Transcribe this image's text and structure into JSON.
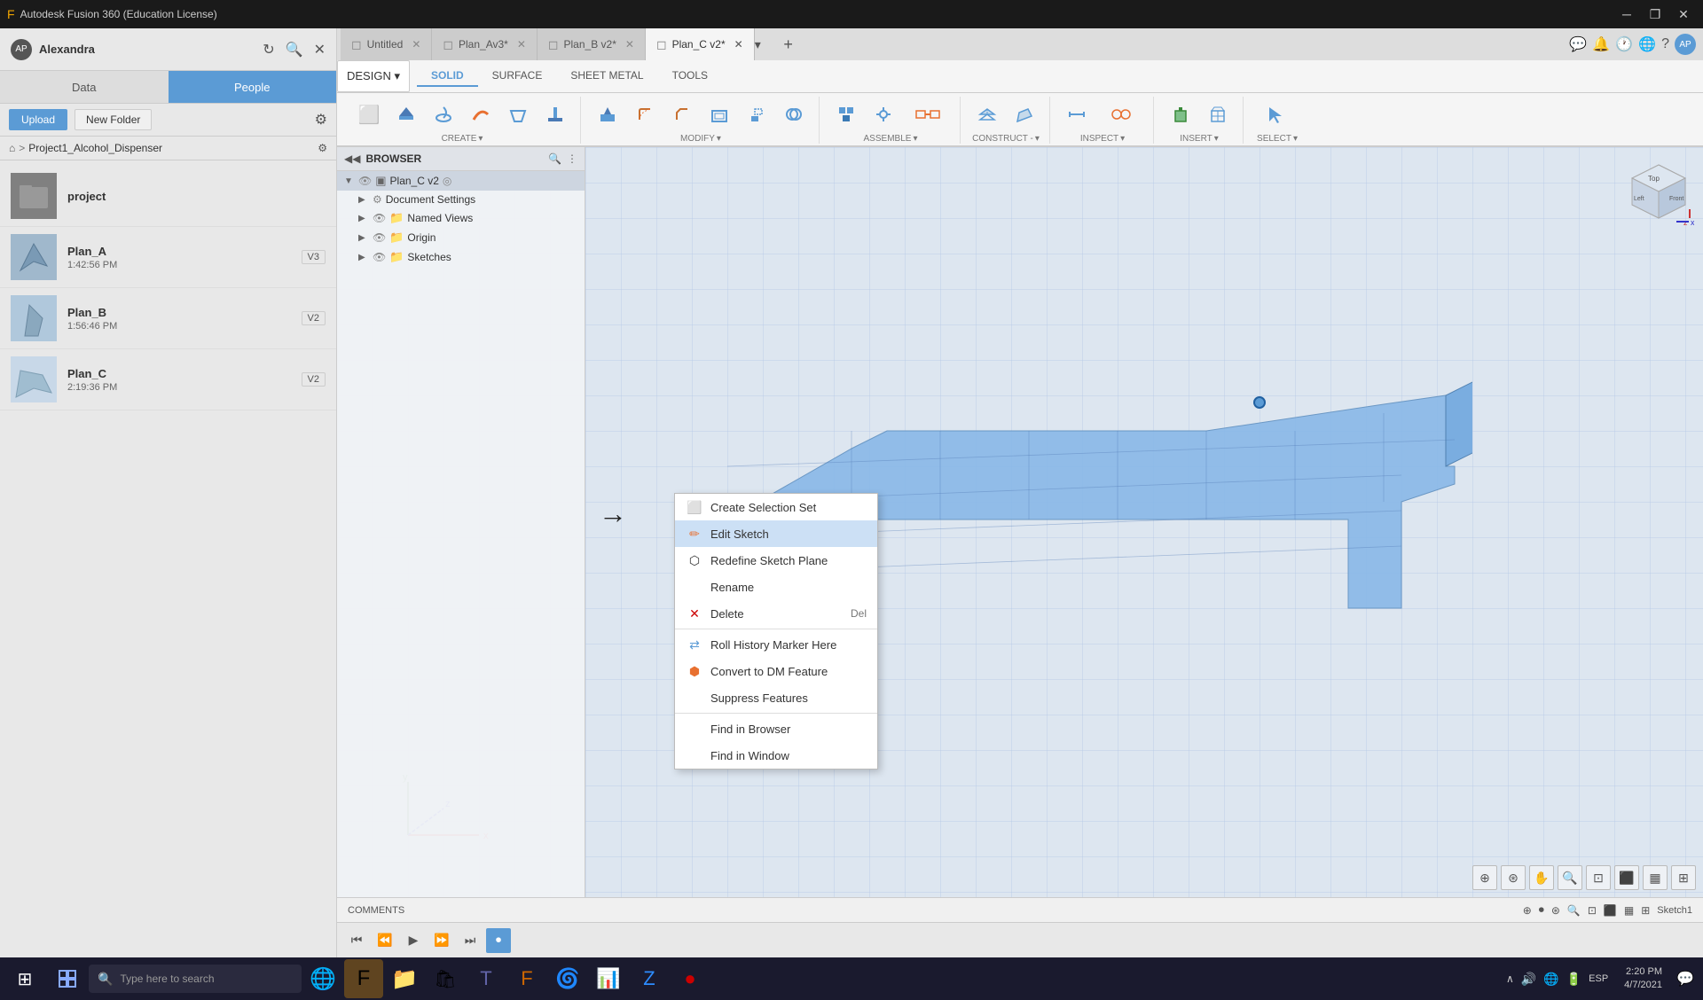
{
  "app": {
    "title": "Autodesk Fusion 360 (Education License)",
    "window_controls": [
      "minimize",
      "restore",
      "close"
    ]
  },
  "user": {
    "name": "Alexandra",
    "initials": "AP"
  },
  "left_panel": {
    "tabs": [
      {
        "id": "data",
        "label": "Data",
        "active": false
      },
      {
        "id": "people",
        "label": "People",
        "active": true
      }
    ],
    "toolbar": {
      "upload_label": "Upload",
      "new_folder_label": "New Folder"
    },
    "breadcrumb": {
      "home": "⌂",
      "project": "Project1_Alcohol_Dispenser"
    },
    "files": [
      {
        "name": "project",
        "type": "folder",
        "time": "",
        "version": ""
      },
      {
        "name": "Plan_A",
        "type": "design",
        "time": "1:42:56 PM",
        "version": "V3"
      },
      {
        "name": "Plan_B",
        "type": "design",
        "time": "1:56:46 PM",
        "version": "V2"
      },
      {
        "name": "Plan_C",
        "type": "design",
        "time": "2:19:36 PM",
        "version": "V2"
      }
    ]
  },
  "editor": {
    "tabs": [
      {
        "id": "untitled",
        "label": "Untitled",
        "active": false,
        "icon": "◻"
      },
      {
        "id": "plan_av3",
        "label": "Plan_Av3*",
        "active": false,
        "icon": "◻"
      },
      {
        "id": "plan_bv2",
        "label": "Plan_B v2*",
        "active": false,
        "icon": "◻"
      },
      {
        "id": "plan_cv2",
        "label": "Plan_C v2*",
        "active": true,
        "icon": "◻"
      }
    ],
    "toolbar_tabs": [
      {
        "id": "solid",
        "label": "SOLID",
        "active": true
      },
      {
        "id": "surface",
        "label": "SURFACE",
        "active": false
      },
      {
        "id": "sheet_metal",
        "label": "SHEET METAL",
        "active": false
      },
      {
        "id": "tools",
        "label": "TOOLS",
        "active": false
      }
    ],
    "design_button": "DESIGN ▾",
    "tool_groups": [
      {
        "id": "create",
        "label": "CREATE",
        "tools": [
          "new-component",
          "extrude",
          "revolve",
          "sweep",
          "loft",
          "rib"
        ]
      },
      {
        "id": "modify",
        "label": "MODIFY",
        "tools": [
          "press-pull",
          "fillet",
          "chamfer",
          "shell",
          "scale",
          "combine"
        ]
      },
      {
        "id": "assemble",
        "label": "ASSEMBLE",
        "tools": [
          "new-component",
          "joint",
          "rigid-group"
        ]
      },
      {
        "id": "construct",
        "label": "CONSTRUCT -",
        "tools": [
          "offset-plane",
          "plane-at-angle",
          "midplane",
          "axis"
        ]
      },
      {
        "id": "inspect",
        "label": "INSPECT",
        "tools": [
          "measure",
          "interference",
          "cross-section"
        ]
      },
      {
        "id": "insert",
        "label": "INSERT",
        "tools": [
          "insert-derive",
          "insert-mesh",
          "insert-svg"
        ]
      },
      {
        "id": "select",
        "label": "SELECT",
        "tools": [
          "select"
        ]
      }
    ]
  },
  "browser": {
    "title": "BROWSER",
    "items": [
      {
        "id": "plan_cv2",
        "label": "Plan_C v2",
        "level": 0,
        "expanded": true,
        "has_eye": true,
        "has_gear": true
      },
      {
        "id": "doc_settings",
        "label": "Document Settings",
        "level": 1,
        "expanded": false
      },
      {
        "id": "named_views",
        "label": "Named Views",
        "level": 1,
        "expanded": false
      },
      {
        "id": "origin",
        "label": "Origin",
        "level": 1,
        "expanded": false
      },
      {
        "id": "sketches",
        "label": "Sketches",
        "level": 1,
        "expanded": false
      }
    ]
  },
  "context_menu": {
    "items": [
      {
        "id": "create-selection-set",
        "label": "Create Selection Set",
        "icon": "⬜",
        "icon_color": "gray",
        "shortcut": ""
      },
      {
        "id": "edit-sketch",
        "label": "Edit Sketch",
        "icon": "✏",
        "icon_color": "orange",
        "shortcut": "",
        "highlighted": true
      },
      {
        "id": "redefine-sketch-plane",
        "label": "Redefine Sketch Plane",
        "icon": "⬡",
        "icon_color": "gray",
        "shortcut": ""
      },
      {
        "id": "rename",
        "label": "Rename",
        "icon": "",
        "icon_color": "gray",
        "shortcut": ""
      },
      {
        "id": "delete",
        "label": "Delete",
        "icon": "✕",
        "icon_color": "red",
        "shortcut": "Del"
      },
      {
        "id": "roll-history",
        "label": "Roll History Marker Here",
        "icon": "⇄",
        "icon_color": "blue",
        "shortcut": ""
      },
      {
        "id": "convert-dm",
        "label": "Convert to DM Feature",
        "icon": "⬢",
        "icon_color": "orange",
        "shortcut": ""
      },
      {
        "id": "suppress",
        "label": "Suppress Features",
        "icon": "",
        "icon_color": "gray",
        "shortcut": ""
      },
      {
        "id": "find-browser",
        "label": "Find in Browser",
        "icon": "",
        "icon_color": "gray",
        "shortcut": ""
      },
      {
        "id": "find-window",
        "label": "Find in Window",
        "icon": "",
        "icon_color": "gray",
        "shortcut": ""
      }
    ]
  },
  "status_bar": {
    "comments_label": "COMMENTS",
    "sketch_label": "Sketch1"
  },
  "taskbar": {
    "search_placeholder": "Type here to search",
    "time": "2:20 PM",
    "date": "4/7/2021",
    "keyboard_layout": "ESP"
  }
}
